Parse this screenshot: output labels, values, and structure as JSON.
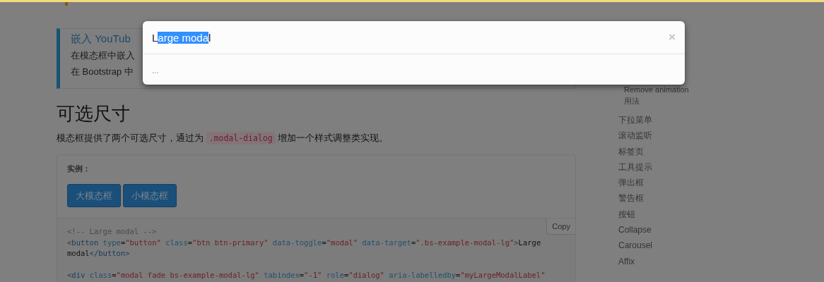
{
  "callout": {
    "title": "嵌入 YouTub",
    "lines": [
      "在模态框中嵌入",
      "在 Bootstrap 中"
    ]
  },
  "section": {
    "heading": "可选尺寸",
    "paragraph": {
      "text_before": "模态框提供了两个可选尺寸，通过为 ",
      "code": ".modal-dialog",
      "text_after": " 增加一个样式调整类实现。"
    }
  },
  "example": {
    "label": "实例：",
    "buttons": [
      "大模态框",
      "小模态框"
    ]
  },
  "code_block": {
    "copy_button": "Copy",
    "lines": [
      {
        "text": "<!-- Large modal -->",
        "blank_line_before": false
      },
      {
        "text": "<button type=\"button\" class=\"btn btn-primary\" data-toggle=\"modal\" data-target=\".bs-example-modal-lg\">Large",
        "blank_line_before": false
      },
      {
        "text": "modal</button>",
        "blank_line_before": false
      },
      {
        "text": "<div class=\"modal fade bs-example-modal-lg\" tabindex=\"-1\" role=\"dialog\" aria-labelledby=\"myLargeModalLabel\"",
        "blank_line_before": true
      }
    ]
  },
  "sidebar": {
    "items": [
      {
        "label": "Remove animation"
      },
      {
        "label": "用法"
      }
    ],
    "sections": [
      "下拉菜单",
      "滚动监听",
      "标签页",
      "工具提示",
      "弹出框",
      "警告框",
      "按钮",
      "Collapse",
      "Carousel",
      "Affix"
    ]
  },
  "modal": {
    "title_parts": [
      {
        "text": "L",
        "highlighted": false
      },
      {
        "text": "arge moda",
        "highlighted": true
      },
      {
        "text": "l",
        "highlighted": false
      }
    ],
    "close": "×",
    "body": "..."
  }
}
